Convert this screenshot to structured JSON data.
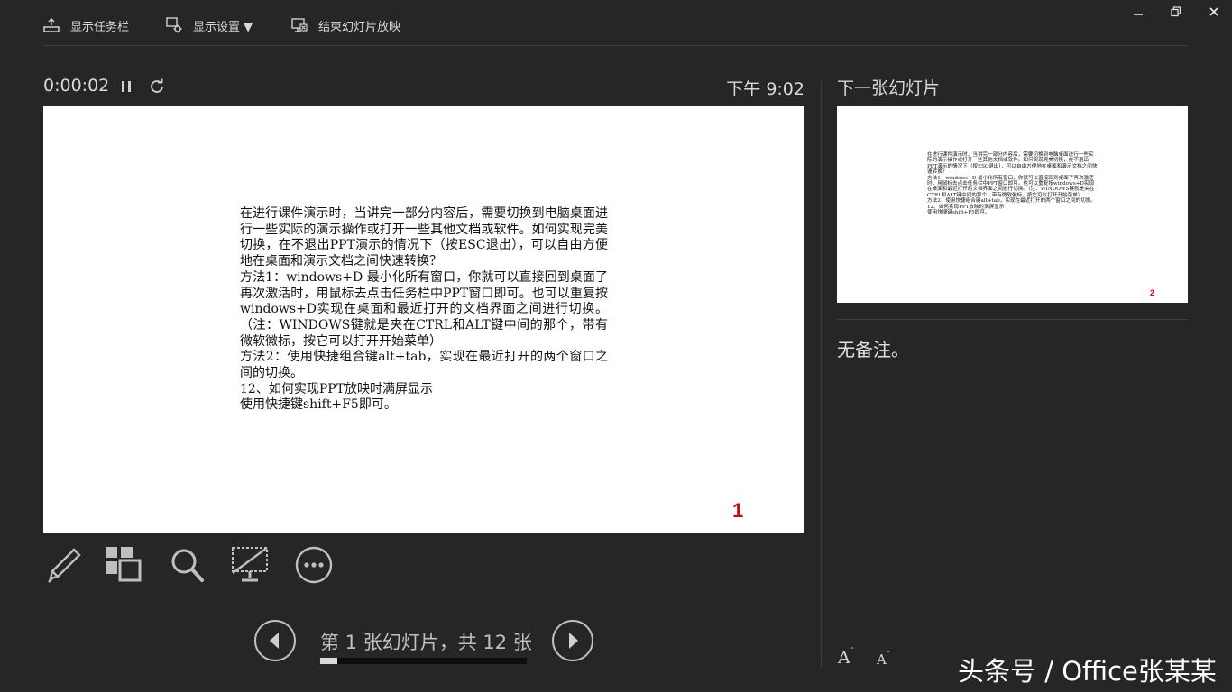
{
  "topbar": {
    "taskbar_label": "显示任务栏",
    "display_settings_label": "显示设置 ▼",
    "end_show_label": "结束幻灯片放映",
    "minimize_icon": "minimize-icon",
    "restore_icon": "restore-icon",
    "close_icon": "close-icon"
  },
  "presenter": {
    "elapsed_time": "0:00:02",
    "clock": "下午 9:02"
  },
  "current_slide": {
    "paragraphs": [
      "在进行课件演示时，当讲完一部分内容后，需要切换到电脑桌面进行一些实际的演示操作或打开一些其他文档或软件。如何实现完美切换，在不退出PPT演示的情况下（按ESC退出），可以自由方便地在桌面和演示文档之间快速转换？",
      "方法1：windows+D 最小化所有窗口，你就可以直接回到桌面了再次激活时，用鼠标去点击任务栏中PPT窗口即可。也可以重复按windows+D实现在桌面和最近打开的文档界面之间进行切换。（注：WINDOWS键就是夹在CTRL和ALT键中间的那个，带有微软徽标，按它可以打开开始菜单）",
      "方法2：使用快捷组合键alt+tab，实现在最近打开的两个窗口之间的切换。",
      "12、如何实现PPT放映时满屏显示",
      "使用快捷键shift+F5即可。"
    ],
    "number": "1"
  },
  "next_slide": {
    "title": "下一张幻灯片",
    "paragraphs": [
      "在进行课件演示时，当讲完一部分内容后，需要切换到电脑桌面进行一些实际的演示操作或打开一些其他文档或软件。如何实现完美切换，在不退出PPT演示的情况下（按ESC退出），可以自由方便地在桌面和演示文档之间快速转换？",
      "方法1：windows+D 最小化所有窗口，你就可以直接回到桌面了再次激活时，用鼠标去点击任务栏中PPT窗口即可。也可以重复按windows+D实现在桌面和最近打开的文档界面之间进行切换。（注：WINDOWS键就是夹在CTRL和ALT键中间的那个，带有微软徽标，按它可以打开开始菜单）",
      "方法2：使用快捷组合键alt+tab，实现在最近打开的两个窗口之间的切换。",
      "12、如何实现PPT放映时满屏显示",
      "使用快捷键shift+F5即可。"
    ],
    "number": "2"
  },
  "notes": {
    "text": "无备注。"
  },
  "tools": [
    "pen-icon",
    "see-all-slides-icon",
    "zoom-icon",
    "black-screen-icon",
    "more-options-icon"
  ],
  "navigation": {
    "counter": "第 1 张幻灯片，共 12 张",
    "current": 1,
    "total": 12,
    "progress_fraction": 0.083
  },
  "font_controls": {
    "increase": "A",
    "decrease": "A"
  },
  "watermark": "头条号 / Office张某某"
}
